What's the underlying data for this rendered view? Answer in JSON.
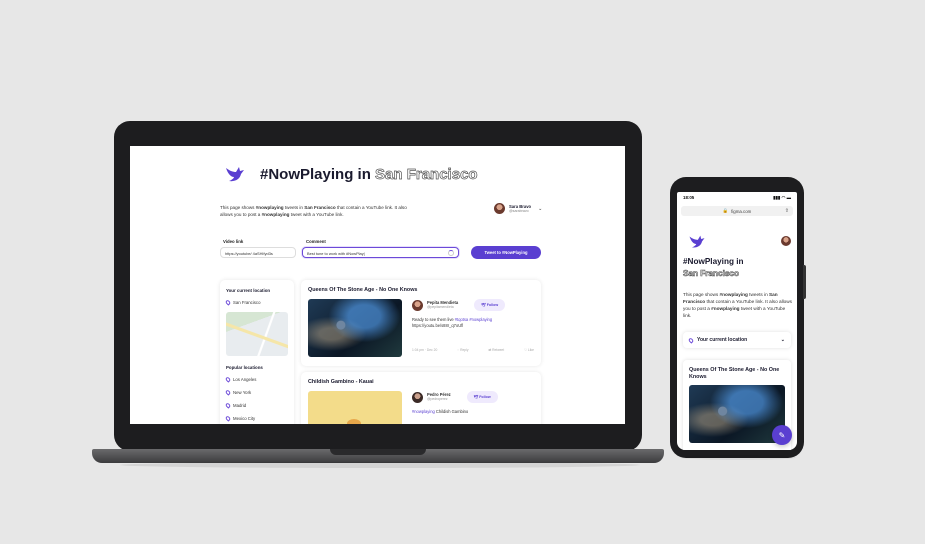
{
  "brand": {
    "accent": "#5a3fd1",
    "device_frame": "#1d1d1f",
    "background": "#e7e7e7"
  },
  "desktop": {
    "title_prefix": "#NowPlaying in",
    "title_city": "San Francisco",
    "description_html_parts": [
      "This page shows ",
      "#nowplaying",
      " tweets in ",
      "San Francisco",
      " that contain a YouTube link. It also allows you to post a ",
      "#nowplaying",
      " tweet with a YouTube link."
    ],
    "user": {
      "name": "Sara Bravo",
      "handle": "@sarabravo"
    },
    "form": {
      "video_label": "Video link",
      "video_value": "https://youtube/ 4aSHIfyd3s",
      "comment_label": "Comment",
      "comment_value": "Best tune to work with #NowPlay|",
      "tweet_button": "Tweet to #NowPlaying"
    },
    "sidebar": {
      "current_title": "Your current location",
      "current_location": "San Francisco",
      "popular_title": "Popular locations",
      "popular": [
        "Los Angeles",
        "New York",
        "Madrid",
        "Mexico City"
      ]
    },
    "cards": [
      {
        "title": "Queens Of The Stone Age - No One Knows",
        "author": "Pepita Mendieta",
        "handle": "@pepitamendieta",
        "follow": "Follow",
        "text_prefix": "Ready to see them live ",
        "text_tags": "#tqotsa #nowplaying",
        "link": "https://youtu.be/s88r_q7oUfl",
        "date": "1:04 pm · Dec 20",
        "actions": [
          "Reply",
          "Retweet",
          "Like"
        ]
      },
      {
        "title": "Childish Gambino - Kauai",
        "author": "Pedro Pérez",
        "handle": "@pedroperez",
        "follow": "Follow",
        "text_tags": "#nowplaying",
        "text_suffix": " Childish Gambino"
      }
    ]
  },
  "mobile": {
    "time": "18:05",
    "signal": "▮▮▮ ◠ ▬",
    "url": "figma.com",
    "title_prefix": "#NowPlaying in",
    "title_city": "San Francisco",
    "description_parts": [
      "This page shows ",
      "#nowplaying",
      " tweets in ",
      "San Francisco",
      " that contain a YouTube link. It also allows you to post a ",
      "#nowplaying",
      " tweet with a YouTube link."
    ],
    "location_label": "Your current location",
    "card_title": "Queens Of The Stone Age - No One Knows"
  }
}
